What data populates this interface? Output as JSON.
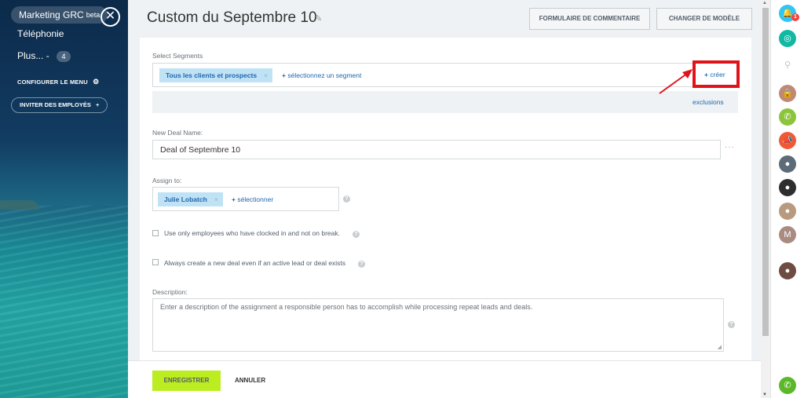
{
  "sidebar": {
    "app_pill": "Marketing GRC",
    "app_pill_sup": "beta",
    "telephony": "Téléphonie",
    "more": "Plus...",
    "more_sep": "-",
    "more_count": "4",
    "configure": "CONFIGURER LE MENU",
    "invite": "INVITER DES EMPLOYÉS"
  },
  "header": {
    "title": "Custom du Septembre 10",
    "btn_feedback": "FORMULAIRE DE COMMENTAIRE",
    "btn_template": "CHANGER DE MODÈLE"
  },
  "segments": {
    "label": "Select Segments",
    "chip": "Tous les clients et prospects",
    "add_link": "sélectionnez un segment",
    "create_link": "créer",
    "exclusions": "exclusions"
  },
  "deal_name": {
    "label": "New Deal Name:",
    "value": "Deal of Septembre 10"
  },
  "assign": {
    "label": "Assign to:",
    "chip": "Julie Lobatch",
    "add_link": "sélectionner"
  },
  "options": {
    "clocked_in": "Use only employees who have clocked in and not on break.",
    "always_create": "Always create a new deal even if an active lead or deal exists"
  },
  "description": {
    "label": "Description:",
    "placeholder": "Enter a description of the assignment a responsible person has to accomplish while processing repeat leads and deals."
  },
  "footer": {
    "save": "ENREGISTRER",
    "cancel": "ANNULER"
  },
  "rail": {
    "notification_count": "1",
    "avatar_letter": "M"
  },
  "colors": {
    "accent_blue": "#2067b0",
    "chip_bg": "#bfe2f5",
    "save_green": "#bbed21",
    "callout_red": "#e0131a"
  }
}
